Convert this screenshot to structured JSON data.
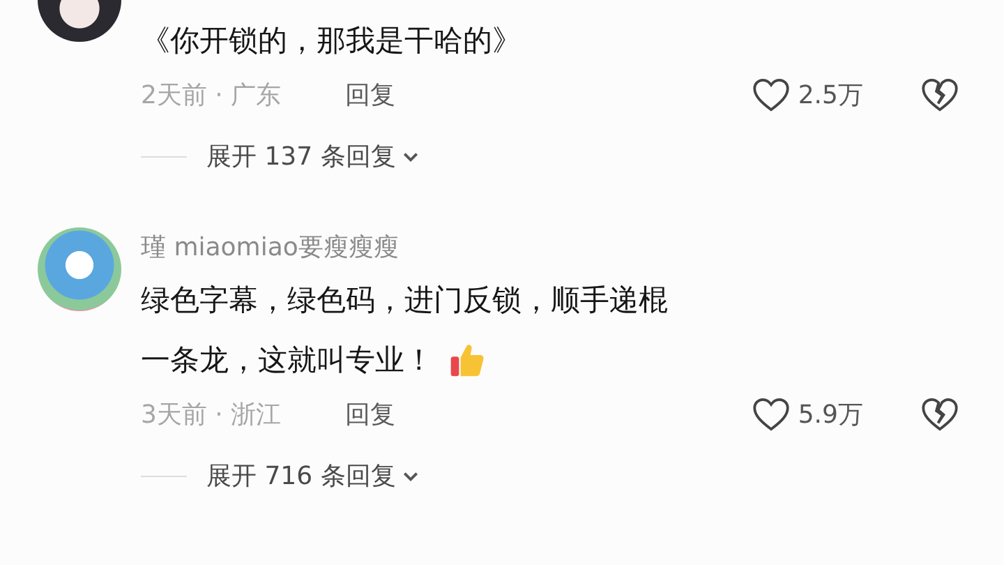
{
  "comments": [
    {
      "lines": [
        "《你开锁的，那我是干哈的》"
      ],
      "time_location": "2天前 · 广东",
      "reply": "回复",
      "liked": false,
      "likes": "2.5万",
      "expand": "展开 137 条回复"
    },
    {
      "username": "瑾 miaomiao要瘦瘦瘦",
      "lines": [
        "绿色字幕，绿色码，进门反锁，顺手递棍",
        "一条龙，这就叫专业！"
      ],
      "emoji": true,
      "time_location": "3天前 · 浙江",
      "reply": "回复",
      "liked": false,
      "likes": "5.9万",
      "expand": "展开 716 条回复"
    }
  ]
}
